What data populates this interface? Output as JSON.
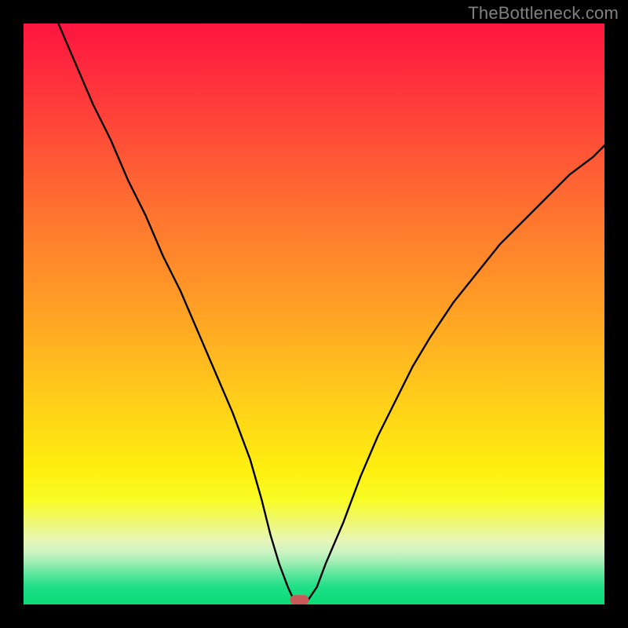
{
  "watermark": "TheBottleneck.com",
  "chart_data": {
    "type": "line",
    "title": "",
    "xlabel": "",
    "ylabel": "",
    "xlim": [
      0,
      100
    ],
    "ylim": [
      0,
      100
    ],
    "grid": false,
    "series": [
      {
        "name": "curve",
        "x": [
          6,
          9,
          12,
          15,
          18,
          21,
          24,
          27,
          30,
          33,
          36,
          39,
          41,
          42.5,
          44,
          45.5,
          46.5,
          49,
          50.5,
          52,
          55,
          58,
          61,
          64,
          67,
          70,
          74,
          78,
          82,
          86,
          90,
          94,
          98,
          100
        ],
        "y": [
          100,
          93,
          86,
          80,
          73,
          67,
          60,
          54,
          47,
          40,
          33,
          25,
          18,
          12,
          7,
          3,
          0.8,
          0.8,
          3,
          7,
          14,
          22,
          29,
          35,
          41,
          46,
          52,
          57,
          62,
          66,
          70,
          74,
          77,
          79
        ]
      }
    ],
    "marker": {
      "name": "pill-marker",
      "x": 47.5,
      "y": 0.8,
      "color": "#c95a5a"
    }
  }
}
